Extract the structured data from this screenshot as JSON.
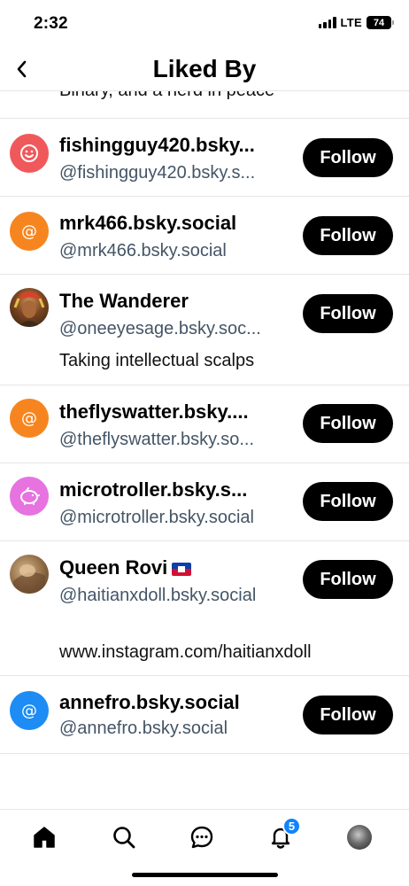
{
  "status_bar": {
    "time": "2:32",
    "network": "LTE",
    "battery": "74"
  },
  "header": {
    "title": "Liked By"
  },
  "cut_item": {
    "bio": "Binary, and a nerd in peace"
  },
  "users": [
    {
      "name": "fishingguy420.bsky...",
      "handle": "@fishingguy420.bsky.s...",
      "follow_label": "Follow",
      "avatar_color": "#f0595b",
      "avatar_icon": "smiley-icon"
    },
    {
      "name": "mrk466.bsky.social",
      "handle": "@mrk466.bsky.social",
      "follow_label": "Follow",
      "avatar_color": "#f7851f",
      "avatar_icon": "at-icon"
    },
    {
      "name": "The Wanderer",
      "handle": "@oneeyesage.bsky.soc...",
      "bio": "Taking intellectual scalps",
      "follow_label": "Follow",
      "avatar_color": "#6b3b1c",
      "avatar_icon": "photo-avatar"
    },
    {
      "name": "theflyswatter.bsky....",
      "handle": "@theflyswatter.bsky.so...",
      "follow_label": "Follow",
      "avatar_color": "#f7851f",
      "avatar_icon": "at-icon"
    },
    {
      "name": "microtroller.bsky.s...",
      "handle": "@microtroller.bsky.social",
      "follow_label": "Follow",
      "avatar_color": "#e673e0",
      "avatar_icon": "piggy-bank-icon"
    },
    {
      "name": "Queen Rovi",
      "handle": "@haitianxdoll.bsky.social",
      "bio": "www.instagram.com/haitianxdoll",
      "follow_label": "Follow",
      "avatar_color": "#a88660",
      "avatar_icon": "photo-avatar"
    },
    {
      "name": "annefro.bsky.social",
      "handle": "@annefro.bsky.social",
      "follow_label": "Follow",
      "avatar_color": "#1d8cf4",
      "avatar_icon": "at-icon"
    }
  ],
  "tabbar": {
    "notifications_badge": "5",
    "tabs": [
      "home-icon",
      "search-icon",
      "chat-icon",
      "bell-icon",
      "profile-avatar"
    ]
  },
  "colors": {
    "accent": "#1083fe",
    "follow_button": "#000000",
    "handle_text": "#445566",
    "divider": "#e6e6e6"
  }
}
